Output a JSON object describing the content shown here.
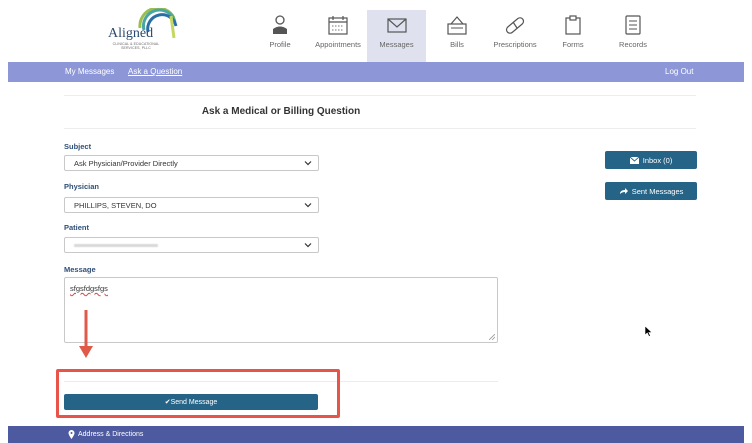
{
  "brand": {
    "name": "Aligned",
    "tagline": "CLINICAL & EDUCATIONAL SERVICES, PLLC"
  },
  "nav": [
    {
      "label": "Profile",
      "icon": "profile-icon"
    },
    {
      "label": "Appointments",
      "icon": "calendar-icon"
    },
    {
      "label": "Messages",
      "icon": "envelope-icon",
      "active": true
    },
    {
      "label": "Bills",
      "icon": "bills-icon"
    },
    {
      "label": "Prescriptions",
      "icon": "pill-icon"
    },
    {
      "label": "Forms",
      "icon": "clipboard-icon"
    },
    {
      "label": "Records",
      "icon": "records-icon"
    }
  ],
  "subnav": {
    "my_messages": "My Messages",
    "ask_question": "Ask a Question",
    "logout": "Log Out"
  },
  "page": {
    "title": "Ask a Medical or Billing Question"
  },
  "form": {
    "subject_label": "Subject",
    "subject_value": "Ask Physician/Provider Directly",
    "physician_label": "Physician",
    "physician_value": "PHILLIPS, STEVEN, DO",
    "patient_label": "Patient",
    "message_label": "Message",
    "message_value": "sfgsfdgsfgs",
    "send_label": "✔Send Message"
  },
  "sidebar": {
    "inbox_label": "Inbox (0)",
    "sent_label": "Sent Messages"
  },
  "footer": {
    "address_label": "Address & Directions"
  },
  "colors": {
    "subnav": "#8d97d8",
    "button": "#266487",
    "footer": "#4e5aa0",
    "highlight": "#e8544a",
    "label": "#2f4f77"
  }
}
